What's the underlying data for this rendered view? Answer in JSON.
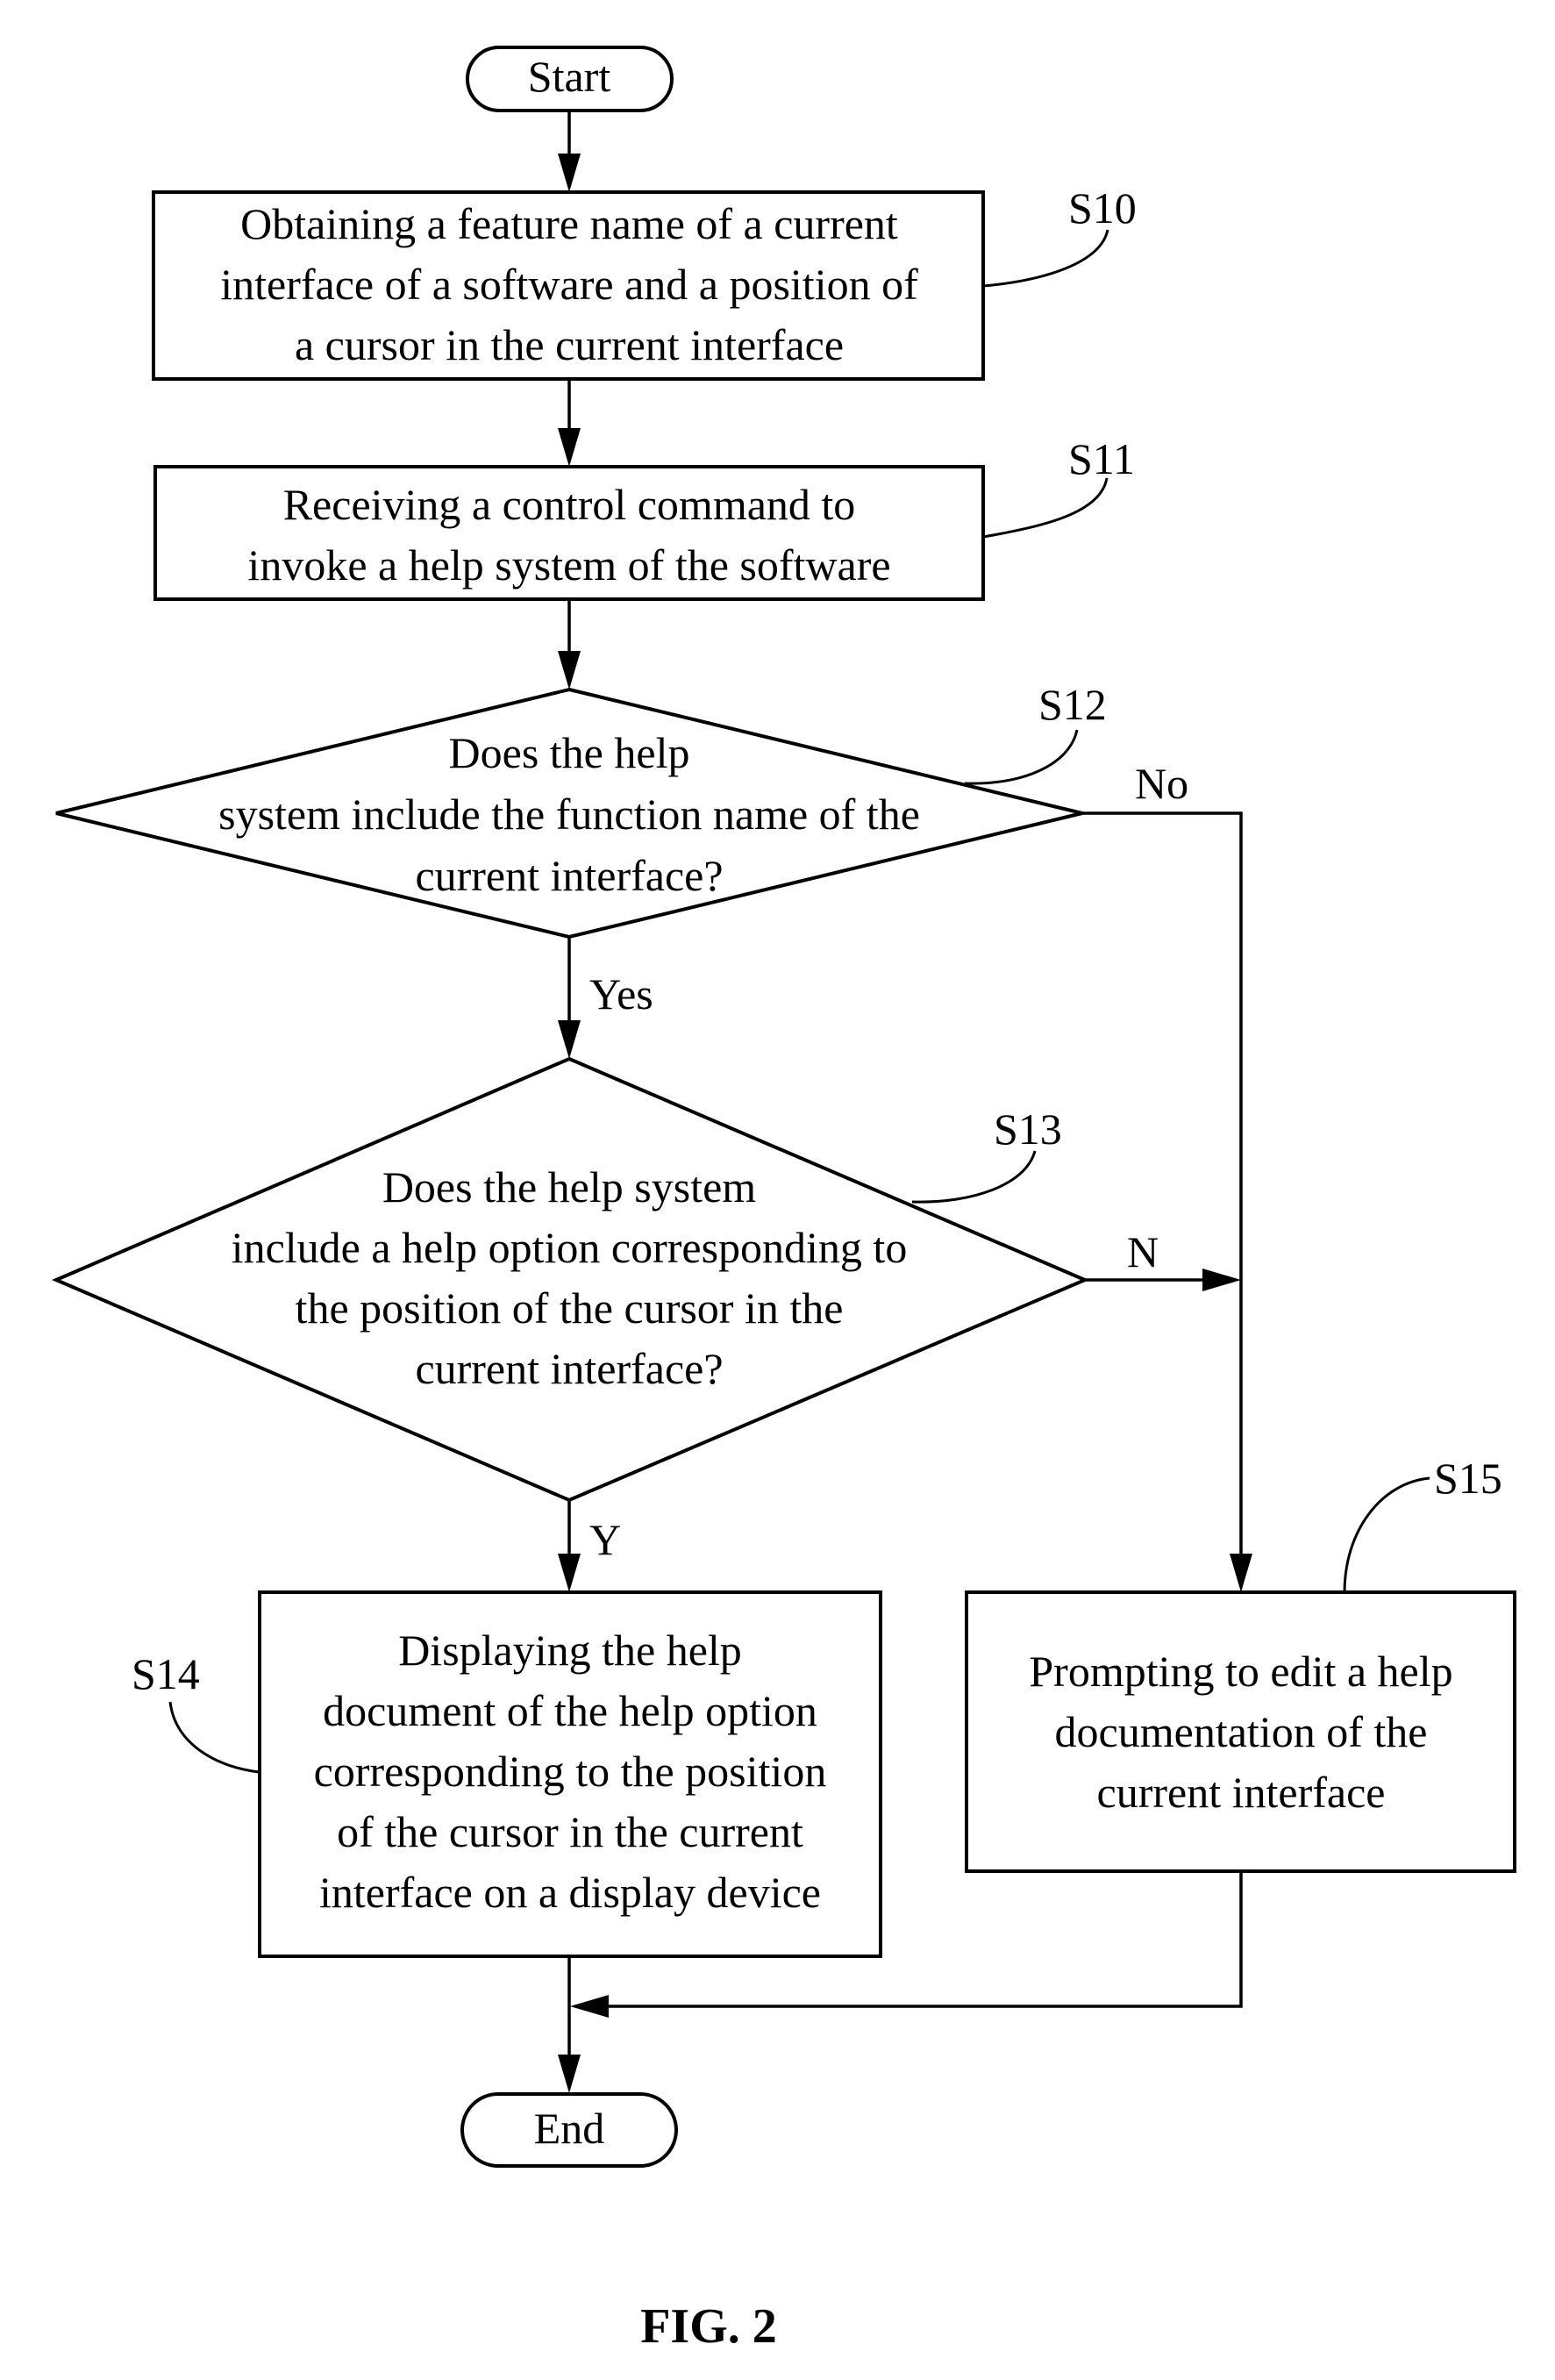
{
  "figure": {
    "caption": "FIG. 2",
    "terminals": {
      "start": "Start",
      "end": "End"
    },
    "steps": {
      "s10": {
        "ref": "S10",
        "lines": [
          "Obtaining a feature name of a current",
          "interface of a software and a position of",
          "a cursor in the current interface"
        ]
      },
      "s11": {
        "ref": "S11",
        "lines": [
          "Receiving a control command to",
          "invoke a help system of the software"
        ]
      },
      "s12": {
        "ref": "S12",
        "lines": [
          "Does the help",
          "system include the function name of the",
          "current interface?"
        ],
        "yes_label": "Yes",
        "no_label": "No"
      },
      "s13": {
        "ref": "S13",
        "lines": [
          "Does the help system",
          "include a help option corresponding to",
          "the position of the cursor in the",
          "current interface?"
        ],
        "yes_label": "Y",
        "no_label": "N"
      },
      "s14": {
        "ref": "S14",
        "lines": [
          "Displaying the help",
          "document of the help option",
          "corresponding to the position",
          "of the cursor in the current",
          "interface on a display device"
        ]
      },
      "s15": {
        "ref": "S15",
        "lines": [
          "Prompting to edit a help",
          "documentation of the",
          "current interface"
        ]
      }
    }
  }
}
